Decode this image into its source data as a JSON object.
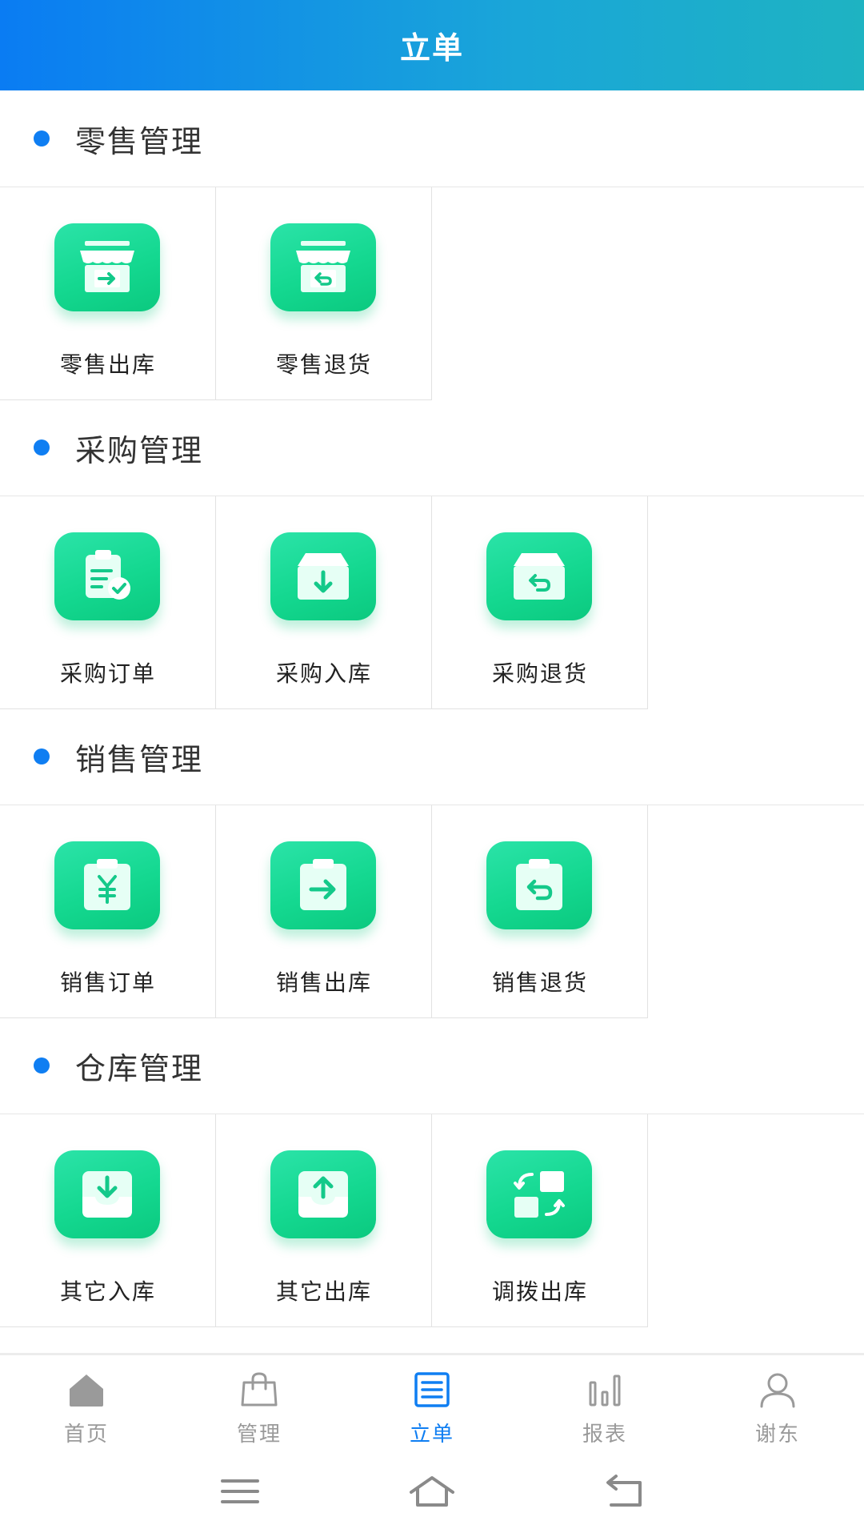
{
  "header": {
    "title": "立单"
  },
  "sections": [
    {
      "title": "零售管理",
      "items": [
        {
          "label": "零售出库",
          "icon": "store-out-icon"
        },
        {
          "label": "零售退货",
          "icon": "store-return-icon"
        }
      ]
    },
    {
      "title": "采购管理",
      "items": [
        {
          "label": "采购订单",
          "icon": "clipboard-check-icon"
        },
        {
          "label": "采购入库",
          "icon": "box-in-icon"
        },
        {
          "label": "采购退货",
          "icon": "box-return-icon"
        }
      ]
    },
    {
      "title": "销售管理",
      "items": [
        {
          "label": "销售订单",
          "icon": "clipboard-yen-icon"
        },
        {
          "label": "销售出库",
          "icon": "clipboard-arrow-right-icon"
        },
        {
          "label": "销售退货",
          "icon": "clipboard-return-icon"
        }
      ]
    },
    {
      "title": "仓库管理",
      "items": [
        {
          "label": "其它入库",
          "icon": "tray-download-icon"
        },
        {
          "label": "其它出库",
          "icon": "tray-upload-icon"
        },
        {
          "label": "调拨出库",
          "icon": "transfer-icon"
        }
      ]
    }
  ],
  "tabbar": [
    {
      "label": "首页",
      "icon": "home-icon",
      "active": false
    },
    {
      "label": "管理",
      "icon": "bag-icon",
      "active": false
    },
    {
      "label": "立单",
      "icon": "order-form-icon",
      "active": true
    },
    {
      "label": "报表",
      "icon": "bar-chart-icon",
      "active": false
    },
    {
      "label": "谢东",
      "icon": "user-icon",
      "active": false
    }
  ],
  "system_nav": [
    {
      "icon": "menu-icon"
    },
    {
      "icon": "home-outline-icon"
    },
    {
      "icon": "back-icon"
    }
  ],
  "colors": {
    "header_start": "#0a7cf3",
    "header_end": "#1eb3c2",
    "accent": "#0f7ef2",
    "tile_icon": "#14d890",
    "tab_inactive": "#9a9a9a"
  }
}
